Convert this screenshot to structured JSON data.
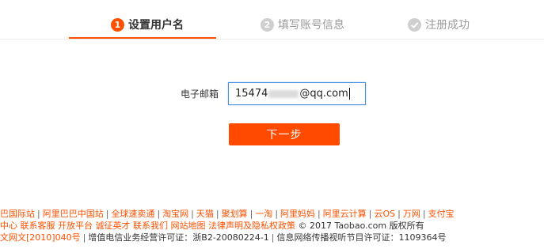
{
  "steps": [
    {
      "num": "1",
      "label": "设置用户名"
    },
    {
      "num": "2",
      "label": "填写账号信息"
    },
    {
      "icon": "check-circle-icon",
      "label": "注册成功"
    }
  ],
  "form": {
    "email_label": "电子邮箱",
    "email_prefix": "15474",
    "email_suffix": "@qq.com",
    "next_label": "下一步"
  },
  "footer": {
    "line1": [
      "巴国际站",
      "阿里巴巴中国站",
      "全球速卖通",
      "淘宝网",
      "天猫",
      "聚划算",
      "一淘",
      "阿里妈妈",
      "阿里云计算",
      "云OS",
      "万网",
      "支付宝"
    ],
    "line2_links": [
      "中心",
      "联系客服",
      "开放平台",
      "诚征英才",
      "联系我们",
      "网站地图",
      "法律声明及隐私权政策"
    ],
    "line2_copyright": "© 2017 Taobao.com 版权所有",
    "line3_link": "文网文[2010]040号",
    "line3_icp": "增值电信业务经营许可证：浙B2-20080224-1",
    "line3_av": "信息网络传播视听节目许可证：1109364号"
  },
  "colors": {
    "accent": "#ff5000",
    "input_focus": "#4a90e2"
  }
}
